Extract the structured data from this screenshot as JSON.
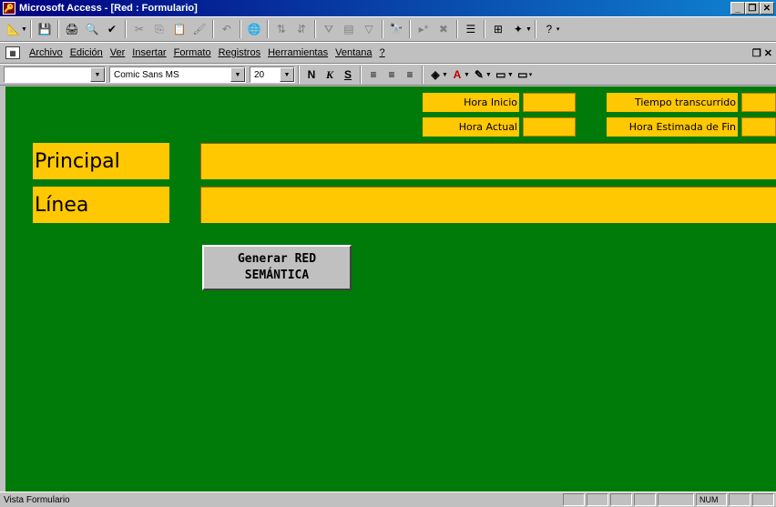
{
  "window": {
    "title": "Microsoft Access - [Red : Formulario]",
    "minimize": "_",
    "restore": "ð",
    "close": "×"
  },
  "menu": {
    "items": [
      "Archivo",
      "Edición",
      "Ver",
      "Insertar",
      "Formato",
      "Registros",
      "Herramientas",
      "Ventana",
      "?"
    ],
    "restore_glyph": "ð"
  },
  "format_bar": {
    "object_combo": "",
    "font_name": "Comic Sans MS",
    "font_size": "20",
    "bold": "N",
    "italic": "K",
    "underline": "S"
  },
  "form": {
    "hora_inicio_label": "Hora Inicio",
    "hora_actual_label": "Hora Actual",
    "tiempo_transcurrido_label": "Tiempo transcurrido",
    "hora_estimada_label": "Hora Estimada de Fin",
    "principal_label": "Principal",
    "linea_label": "Línea",
    "generate_button": "Generar RED\nSEMÁNTICA"
  },
  "status": {
    "text": "Vista Formulario",
    "num": "NUM"
  },
  "colors": {
    "form_background": "#007a08",
    "field_background": "#ffc800",
    "title_bar": "#000080"
  }
}
